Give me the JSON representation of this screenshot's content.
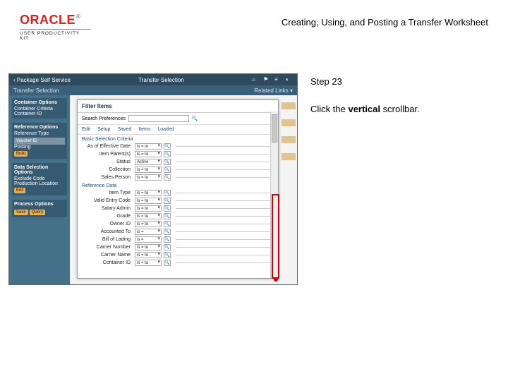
{
  "header": {
    "brand": "ORACLE",
    "brand_sub": "USER PRODUCTIVITY KIT",
    "title": "Creating, Using, and Posting a Transfer Worksheet"
  },
  "step": {
    "label": "Step 23"
  },
  "instruction": {
    "prefix": "Click the ",
    "bold": "vertical",
    "suffix": " scrollbar."
  },
  "shot": {
    "back_link": "‹  Package Self Service",
    "page_title": "Transfer Selection",
    "secondbar_left": "Transfer Selection",
    "secondbar_right": "Related Links ▾",
    "side": {
      "g1_title": "Container Options",
      "g1_a": "Container Criteria",
      "g1_b": "Container ID",
      "g2_title": "Reference Options",
      "g2_a": "Reference Type",
      "g2_b": "Voucher ID",
      "g2_c": "Posting",
      "g2_pill": "Build",
      "g3_title": "Data Selection Options",
      "g3_a": "Exclude Code",
      "g3_b": "Production Location",
      "g3_btn": "Edit",
      "g4_title": "Process Options",
      "g4_a": "Save",
      "g4_b": "Query"
    },
    "modal": {
      "title": "Filter Items",
      "search_label": "Search Preferences",
      "search_icon": "🔍",
      "tabs": {
        "a": "Edit",
        "b": "Setup",
        "c": "Saved",
        "d": "Items",
        "e": "Loaded"
      },
      "sec1": "Basic Selection Criteria",
      "rows1": [
        {
          "lab": "As of Effective Date",
          "val": "is = to"
        },
        {
          "lab": "Item Parent(s)",
          "val": "is = to"
        },
        {
          "lab": "Status",
          "val": "Active"
        },
        {
          "lab": "Collection",
          "val": "is = to"
        },
        {
          "lab": "Sales Person",
          "val": "is = to"
        }
      ],
      "sec2": "Reference Data",
      "rows2": [
        {
          "lab": "Item Type",
          "val": "is = to"
        },
        {
          "lab": "Valid Entry Code",
          "val": "is = to"
        },
        {
          "lab": "Salary Admin",
          "val": "is = to"
        },
        {
          "lab": "Grade",
          "val": "is = to"
        },
        {
          "lab": "Owner ID",
          "val": "is = to"
        },
        {
          "lab": "Accounted To",
          "val": "is = "
        },
        {
          "lab": "Bill of Lading",
          "val": "is = "
        },
        {
          "lab": "Carrier Number",
          "val": "is = to"
        },
        {
          "lab": "Carrier Name",
          "val": "is = to"
        },
        {
          "lab": "Container ID",
          "val": "is = to"
        }
      ]
    }
  }
}
